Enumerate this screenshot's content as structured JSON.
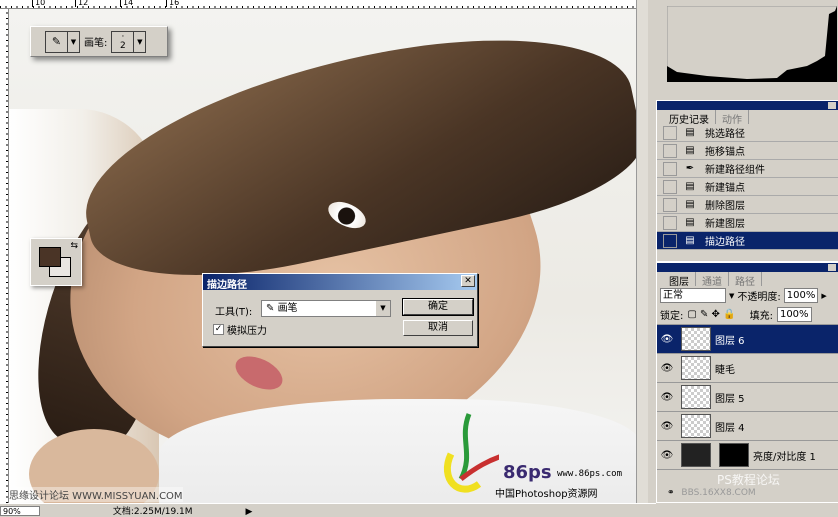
{
  "ruler": {
    "ticks": [
      "10",
      "12",
      "14",
      "16"
    ]
  },
  "options_bar": {
    "brush_label": "画笔:",
    "brush_size": "2",
    "tool_icon": "brush-icon"
  },
  "dialog": {
    "title": "描边路径",
    "tool_label": "工具(T):",
    "tool_value": "画笔",
    "simulate_pressure_label": "模拟压力",
    "simulate_pressure_checked": true,
    "ok_label": "确定",
    "cancel_label": "取消"
  },
  "history": {
    "tabs": [
      "历史记录",
      "动作"
    ],
    "items": [
      {
        "label": "挑选路径",
        "icon": "history-state-icon"
      },
      {
        "label": "拖移锚点",
        "icon": "history-state-icon"
      },
      {
        "label": "新建路径组件",
        "icon": "pen-icon"
      },
      {
        "label": "新建锚点",
        "icon": "history-state-icon"
      },
      {
        "label": "删除图层",
        "icon": "history-state-icon"
      },
      {
        "label": "新建图层",
        "icon": "history-state-icon"
      },
      {
        "label": "描边路径",
        "icon": "history-state-icon",
        "selected": true
      }
    ]
  },
  "layers": {
    "tabs": [
      "图层",
      "通道",
      "路径"
    ],
    "blend_mode": "正常",
    "opacity_label": "不透明度:",
    "opacity": "100%",
    "lock_label": "锁定:",
    "fill_label": "填充:",
    "fill": "100%",
    "items": [
      {
        "name": "图层 6",
        "selected": true
      },
      {
        "name": "睫毛"
      },
      {
        "name": "图层 5"
      },
      {
        "name": "图层 4"
      },
      {
        "name": "亮度/对比度 1"
      }
    ]
  },
  "status": {
    "zoom": "90%",
    "doc": "文档:2.25M/19.1M"
  },
  "watermarks": {
    "missyuan": "思缘设计论坛 WWW.MISSYUAN.COM",
    "site_logo": "86ps",
    "site_url": "www.86ps.com",
    "site_name": "中国Photoshop资源网",
    "forum": "PS教程论坛",
    "bbs": "BBS.16XX8.COM"
  },
  "colors": {
    "foreground": "#4a3426",
    "background": "#e9e6e2",
    "selection": "#0a246a"
  }
}
